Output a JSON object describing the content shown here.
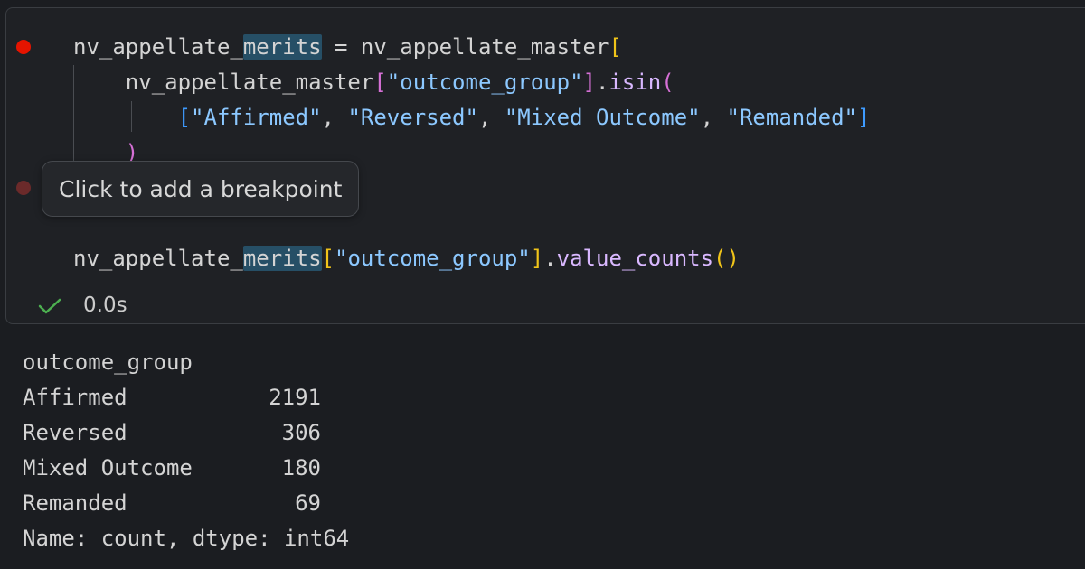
{
  "code": {
    "line1": {
      "var": "nv_appellate_",
      "var_highlight": "merits",
      "assign": " = nv_appellate_master",
      "open_bracket": "["
    },
    "line2": {
      "indent": "    ",
      "text": "nv_appellate_master",
      "open_bracket": "[",
      "string": "\"outcome_group\"",
      "close_bracket": "]",
      "dot": ".",
      "method": "isin",
      "open_paren": "("
    },
    "line3": {
      "indent": "        ",
      "open_bracket": "[",
      "items": [
        "\"Affirmed\"",
        "\"Reversed\"",
        "\"Mixed Outcome\"",
        "\"Remanded\""
      ],
      "separator": ", ",
      "close_bracket": "]"
    },
    "line4": {
      "indent": "    ",
      "close_paren": ")"
    },
    "line6": {
      "var": "nv_appellate_",
      "var_highlight": "merits",
      "open_bracket": "[",
      "string": "\"outcome_group\"",
      "close_bracket": "]",
      "dot": ".",
      "method": "value_counts",
      "parens": "()"
    }
  },
  "tooltip": {
    "text": "Click to add a breakpoint"
  },
  "status": {
    "icon": "check-icon",
    "duration": "0.0s"
  },
  "output": {
    "header": "outcome_group",
    "rows": [
      {
        "label": "Affirmed",
        "value": "2191"
      },
      {
        "label": "Reversed",
        "value": "306"
      },
      {
        "label": "Mixed Outcome",
        "value": "180"
      },
      {
        "label": "Remanded",
        "value": "69"
      }
    ],
    "footer": "Name: count, dtype: int64"
  },
  "colors": {
    "breakpoint": "#e51400",
    "success": "#4caf50"
  }
}
